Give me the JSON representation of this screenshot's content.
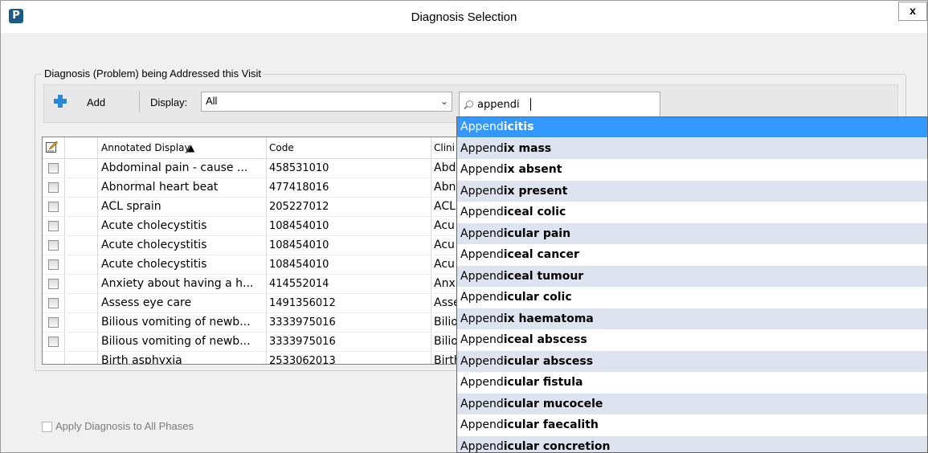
{
  "window": {
    "title": "Diagnosis Selection",
    "app_icon_letter": "P",
    "close_label": "x"
  },
  "group": {
    "title": "Diagnosis (Problem) being Addressed this Visit"
  },
  "toolbar": {
    "add_label": "Add",
    "display_label": "Display:",
    "display_value": "All",
    "search_value": "appendi"
  },
  "grid": {
    "columns": [
      "Annotated Display",
      "Code",
      "Clini"
    ],
    "rows": [
      {
        "display": "Abdominal pain - cause ...",
        "code": "458531010",
        "clinical": "Abd"
      },
      {
        "display": "Abnormal heart beat",
        "code": "477418016",
        "clinical": "Abn"
      },
      {
        "display": "ACL sprain",
        "code": "205227012",
        "clinical": "ACL"
      },
      {
        "display": "Acute cholecystitis",
        "code": "108454010",
        "clinical": "Acu"
      },
      {
        "display": "Acute cholecystitis",
        "code": "108454010",
        "clinical": "Acu"
      },
      {
        "display": "Acute cholecystitis",
        "code": "108454010",
        "clinical": "Acu"
      },
      {
        "display": "Anxiety about having a h...",
        "code": "414552014",
        "clinical": "Anx"
      },
      {
        "display": "Assess eye care",
        "code": "1491356012",
        "clinical": "Asse"
      },
      {
        "display": "Bilious vomiting of newb...",
        "code": "3333975016",
        "clinical": "Bilio"
      },
      {
        "display": "Bilious vomiting of newb...",
        "code": "3333975016",
        "clinical": "Bilio"
      },
      {
        "display": "Birth asphyxia",
        "code": "2533062013",
        "clinical": "Birth"
      }
    ]
  },
  "footer": {
    "apply_label": "Apply Diagnosis to All Phases"
  },
  "suggestions": [
    {
      "prefix": "Append",
      "rest": "icitis"
    },
    {
      "prefix": "Append",
      "rest": "ix mass"
    },
    {
      "prefix": "Append",
      "rest": "ix absent"
    },
    {
      "prefix": "Append",
      "rest": "ix present"
    },
    {
      "prefix": "Append",
      "rest": "iceal colic"
    },
    {
      "prefix": "Append",
      "rest": "icular pain"
    },
    {
      "prefix": "Append",
      "rest": "iceal cancer"
    },
    {
      "prefix": "Append",
      "rest": "iceal tumour"
    },
    {
      "prefix": "Append",
      "rest": "icular colic"
    },
    {
      "prefix": "Append",
      "rest": "ix haematoma"
    },
    {
      "prefix": "Append",
      "rest": "iceal abscess"
    },
    {
      "prefix": "Append",
      "rest": "icular abscess"
    },
    {
      "prefix": "Append",
      "rest": "icular fistula"
    },
    {
      "prefix": "Append",
      "rest": "icular mucocele"
    },
    {
      "prefix": "Append",
      "rest": "icular faecalith"
    },
    {
      "prefix": "Append",
      "rest": "icular concretion"
    }
  ],
  "colors": {
    "selection": "#3399ff",
    "alt_row": "#dde4ef",
    "add_icon": "#2c86d8"
  }
}
